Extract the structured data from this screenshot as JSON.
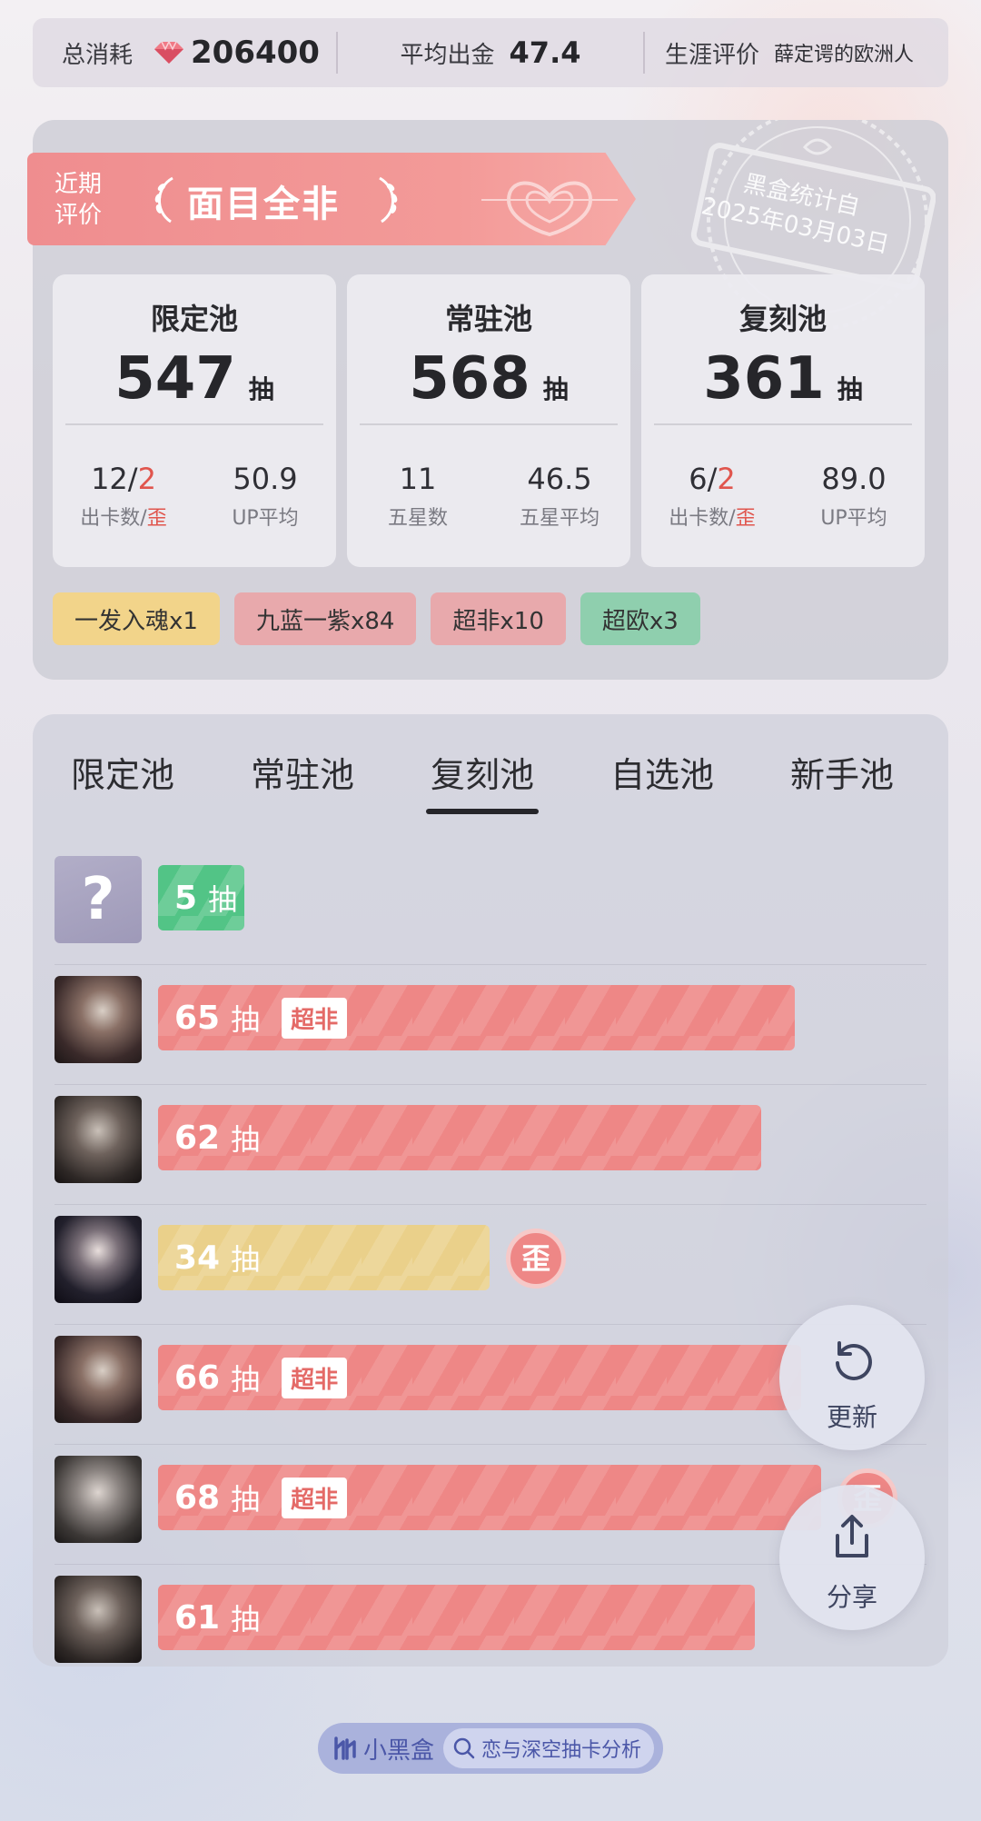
{
  "summary": {
    "total_cost_label": "总消耗",
    "total_cost_value": "206400",
    "avg_label": "平均出金",
    "avg_value": "47.4",
    "career_label": "生涯评价",
    "career_value": "薛定谔的欧洲人",
    "gem_icon": "diamond-gem-icon"
  },
  "recent": {
    "label": "近期评价",
    "value": "面目全非"
  },
  "stamp": {
    "line1": "黑盒统计自",
    "line2": "2025年03月03日"
  },
  "pools": [
    {
      "name": "限定池",
      "count": "547",
      "unit": "抽",
      "left_value_main": "12/",
      "left_value_red": "2",
      "left_key_main": "出卡数/",
      "left_key_red": "歪",
      "right_value": "50.9",
      "right_key": "UP平均"
    },
    {
      "name": "常驻池",
      "count": "568",
      "unit": "抽",
      "left_value_main": "11",
      "left_value_red": "",
      "left_key_main": "五星数",
      "left_key_red": "",
      "right_value": "46.5",
      "right_key": "五星平均"
    },
    {
      "name": "复刻池",
      "count": "361",
      "unit": "抽",
      "left_value_main": "6/",
      "left_value_red": "2",
      "left_key_main": "出卡数/",
      "left_key_red": "歪",
      "right_value": "89.0",
      "right_key": "UP平均"
    }
  ],
  "tags": [
    "一发入魂x1",
    "九蓝一紫x84",
    "超非x10",
    "超欧x3"
  ],
  "tabs": [
    "限定池",
    "常驻池",
    "复刻池",
    "自选池",
    "新手池"
  ],
  "active_tab": "复刻池",
  "history": [
    {
      "count": "5",
      "unit": "抽",
      "flag": "",
      "color": "#52c486",
      "avatar": "?",
      "fill": 0.13,
      "wai": ""
    },
    {
      "count": "65",
      "unit": "抽",
      "flag": "超非",
      "color": "#ee8786",
      "avatar": "",
      "fill": 0.96,
      "wai": ""
    },
    {
      "count": "62",
      "unit": "抽",
      "flag": "",
      "color": "#ee8786",
      "avatar": "",
      "fill": 0.91,
      "wai": ""
    },
    {
      "count": "34",
      "unit": "抽",
      "flag": "",
      "color": "#ead08a",
      "avatar": "",
      "fill": 0.5,
      "wai": "歪"
    },
    {
      "count": "66",
      "unit": "抽",
      "flag": "超非",
      "color": "#ee8786",
      "avatar": "",
      "fill": 0.97,
      "wai": ""
    },
    {
      "count": "68",
      "unit": "抽",
      "flag": "超非",
      "color": "#ee8786",
      "avatar": "",
      "fill": 1.0,
      "wai": "歪"
    },
    {
      "count": "61",
      "unit": "抽",
      "flag": "",
      "color": "#ee8786",
      "avatar": "",
      "fill": 0.9,
      "wai": ""
    }
  ],
  "actions": {
    "refresh_label": "更新",
    "share_label": "分享"
  },
  "footer": {
    "brand": "小黑盒",
    "search_text": "恋与深空抽卡分析"
  }
}
